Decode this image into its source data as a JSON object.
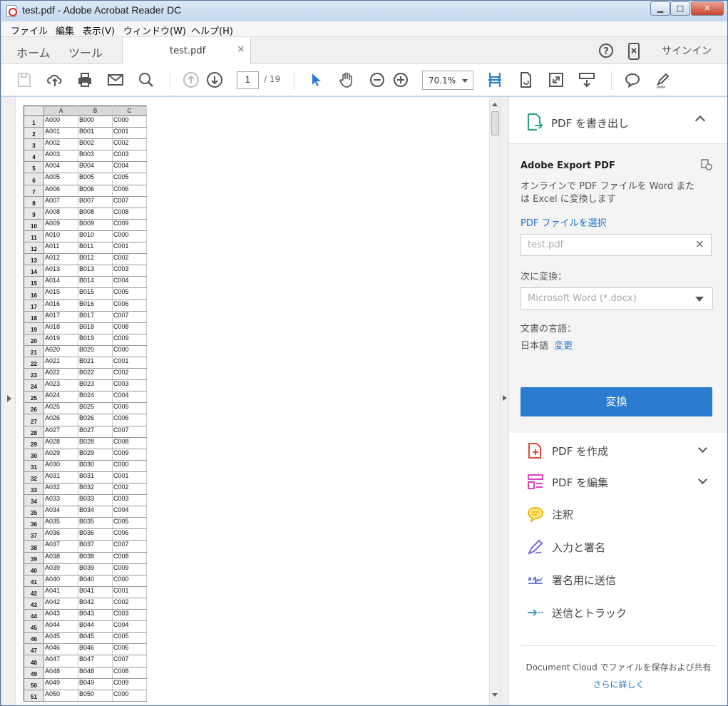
{
  "window": {
    "title": "test.pdf - Adobe Acrobat Reader DC",
    "minimize": "▁",
    "maximize": "□",
    "close": "✕"
  },
  "menu": [
    "ファイル",
    "編集",
    "表示(V)",
    "ウィンドウ(W)",
    "ヘルプ(H)"
  ],
  "tabs": {
    "home": "ホーム",
    "tools": "ツール",
    "document": "test.pdf",
    "signin": "サインイン"
  },
  "toolbar": {
    "page_current": "1",
    "page_total": "/ 19",
    "zoom": "70.1%"
  },
  "sheet": {
    "columns": [
      "A",
      "B",
      "C"
    ],
    "rows": [
      [
        "1",
        "A000",
        "B000",
        "C000"
      ],
      [
        "2",
        "A001",
        "B001",
        "C001"
      ],
      [
        "3",
        "A002",
        "B002",
        "C002"
      ],
      [
        "4",
        "A003",
        "B003",
        "C003"
      ],
      [
        "5",
        "A004",
        "B004",
        "C004"
      ],
      [
        "6",
        "A005",
        "B005",
        "C005"
      ],
      [
        "7",
        "A006",
        "B006",
        "C006"
      ],
      [
        "8",
        "A007",
        "B007",
        "C007"
      ],
      [
        "9",
        "A008",
        "B008",
        "C008"
      ],
      [
        "10",
        "A009",
        "B009",
        "C009"
      ],
      [
        "11",
        "A010",
        "B010",
        "C000"
      ],
      [
        "12",
        "A011",
        "B011",
        "C001"
      ],
      [
        "13",
        "A012",
        "B012",
        "C002"
      ],
      [
        "14",
        "A013",
        "B013",
        "C003"
      ],
      [
        "15",
        "A014",
        "B014",
        "C004"
      ],
      [
        "16",
        "A015",
        "B015",
        "C005"
      ],
      [
        "17",
        "A016",
        "B016",
        "C006"
      ],
      [
        "18",
        "A017",
        "B017",
        "C007"
      ],
      [
        "19",
        "A018",
        "B018",
        "C008"
      ],
      [
        "20",
        "A019",
        "B019",
        "C009"
      ],
      [
        "21",
        "A020",
        "B020",
        "C000"
      ],
      [
        "22",
        "A021",
        "B021",
        "C001"
      ],
      [
        "23",
        "A022",
        "B022",
        "C002"
      ],
      [
        "24",
        "A023",
        "B023",
        "C003"
      ],
      [
        "25",
        "A024",
        "B024",
        "C004"
      ],
      [
        "26",
        "A025",
        "B025",
        "C005"
      ],
      [
        "27",
        "A026",
        "B026",
        "C006"
      ],
      [
        "28",
        "A027",
        "B027",
        "C007"
      ],
      [
        "29",
        "A028",
        "B028",
        "C008"
      ],
      [
        "30",
        "A029",
        "B029",
        "C009"
      ],
      [
        "31",
        "A030",
        "B030",
        "C000"
      ],
      [
        "32",
        "A031",
        "B031",
        "C001"
      ],
      [
        "33",
        "A032",
        "B032",
        "C002"
      ],
      [
        "34",
        "A033",
        "B033",
        "C003"
      ],
      [
        "35",
        "A034",
        "B034",
        "C004"
      ],
      [
        "36",
        "A035",
        "B035",
        "C005"
      ],
      [
        "37",
        "A036",
        "B036",
        "C006"
      ],
      [
        "38",
        "A037",
        "B037",
        "C007"
      ],
      [
        "39",
        "A038",
        "B038",
        "C008"
      ],
      [
        "40",
        "A039",
        "B039",
        "C009"
      ],
      [
        "41",
        "A040",
        "B040",
        "C000"
      ],
      [
        "42",
        "A041",
        "B041",
        "C001"
      ],
      [
        "43",
        "A042",
        "B042",
        "C002"
      ],
      [
        "44",
        "A043",
        "B043",
        "C003"
      ],
      [
        "45",
        "A044",
        "B044",
        "C004"
      ],
      [
        "46",
        "A045",
        "B045",
        "C005"
      ],
      [
        "47",
        "A046",
        "B046",
        "C006"
      ],
      [
        "48",
        "A047",
        "B047",
        "C007"
      ],
      [
        "49",
        "A048",
        "B048",
        "C008"
      ],
      [
        "50",
        "A049",
        "B049",
        "C009"
      ],
      [
        "51",
        "A050",
        "B050",
        "C000"
      ]
    ]
  },
  "panel": {
    "export_header": "PDF を書き出し",
    "export_title": "Adobe Export PDF",
    "export_desc": "オンラインで PDF ファイルを Word または Excel に変換します",
    "select_file": "PDF ファイルを選択",
    "file_value": "test.pdf",
    "convert_to_label": "次に変換：",
    "convert_to_value": "Microsoft Word (*.docx)",
    "lang_label": "文書の言語：",
    "lang_value": "日本語",
    "lang_change": "変更",
    "convert_button": "変換",
    "tools": [
      "PDF を作成",
      "PDF を編集",
      "注釈",
      "入力と署名",
      "署名用に送信",
      "送信とトラック"
    ],
    "footer_text": "Document Cloud でファイルを保存および共有",
    "footer_link": "さらに詳しく"
  },
  "colors": {
    "accent": "#2b7bd1",
    "link": "#2473c6"
  }
}
